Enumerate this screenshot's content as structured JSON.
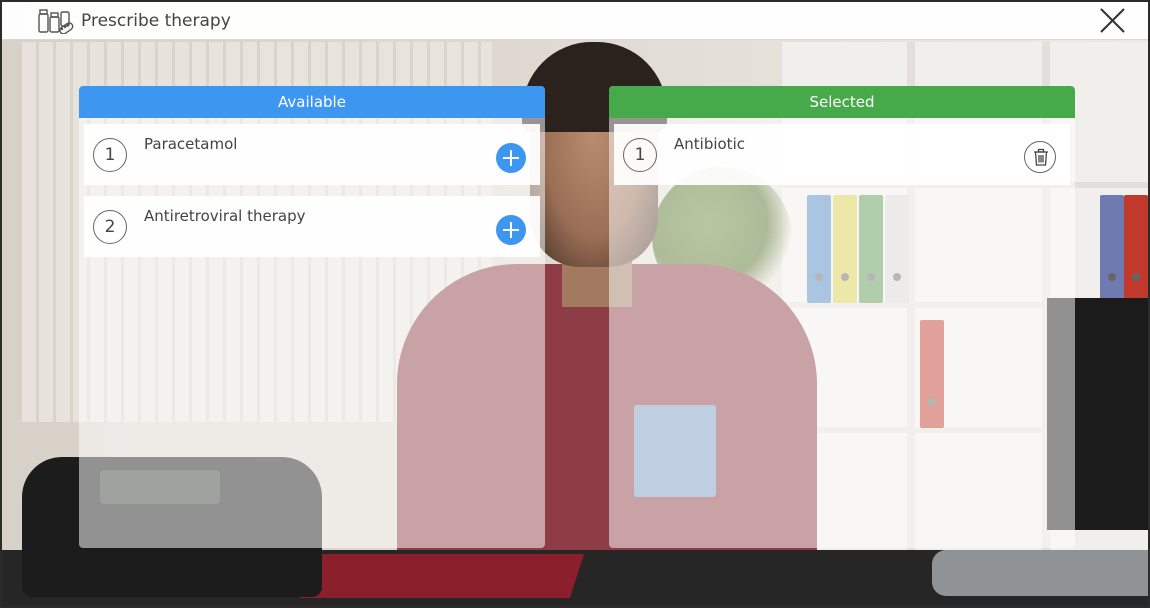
{
  "window": {
    "title": "Prescribe therapy",
    "title_icon": "medicine-bottles-icon",
    "close_icon": "close-icon"
  },
  "available": {
    "header": "Available",
    "header_color": "#3d96f0",
    "items": [
      {
        "number": "1",
        "label": "Paracetamol",
        "action_icon": "plus-icon"
      },
      {
        "number": "2",
        "label": "Antiretroviral therapy",
        "action_icon": "plus-icon"
      }
    ]
  },
  "selected": {
    "header": "Selected",
    "header_color": "#47aa4a",
    "items": [
      {
        "number": "1",
        "label": "Antibiotic",
        "action_icon": "trash-icon"
      }
    ]
  }
}
